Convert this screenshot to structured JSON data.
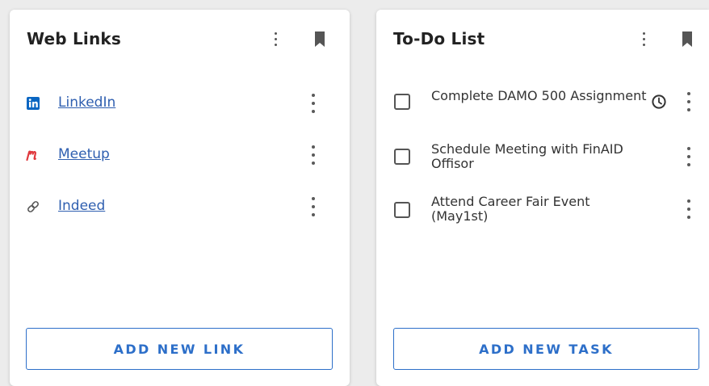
{
  "web_links": {
    "title": "Web Links",
    "links": [
      {
        "label": "LinkedIn",
        "icon": "linkedin-icon"
      },
      {
        "label": "Meetup",
        "icon": "meetup-icon"
      },
      {
        "label": "Indeed",
        "icon": "link-icon"
      }
    ],
    "add_button": "ADD NEW LINK"
  },
  "todo": {
    "title": "To-Do List",
    "tasks": [
      {
        "label": "Complete DAMO 500 Assignment",
        "checked": false,
        "has_reminder": true
      },
      {
        "label": "Schedule Meeting with FinAID Offisor",
        "checked": false,
        "has_reminder": false
      },
      {
        "label": "Attend Career Fair Event (May1st)",
        "checked": false,
        "has_reminder": false
      }
    ],
    "add_button": "ADD NEW TASK"
  },
  "colors": {
    "accent": "#2d6fc9",
    "link": "#2f5fb0",
    "linkedin": "#0a66c2",
    "meetup": "#e0393e"
  }
}
